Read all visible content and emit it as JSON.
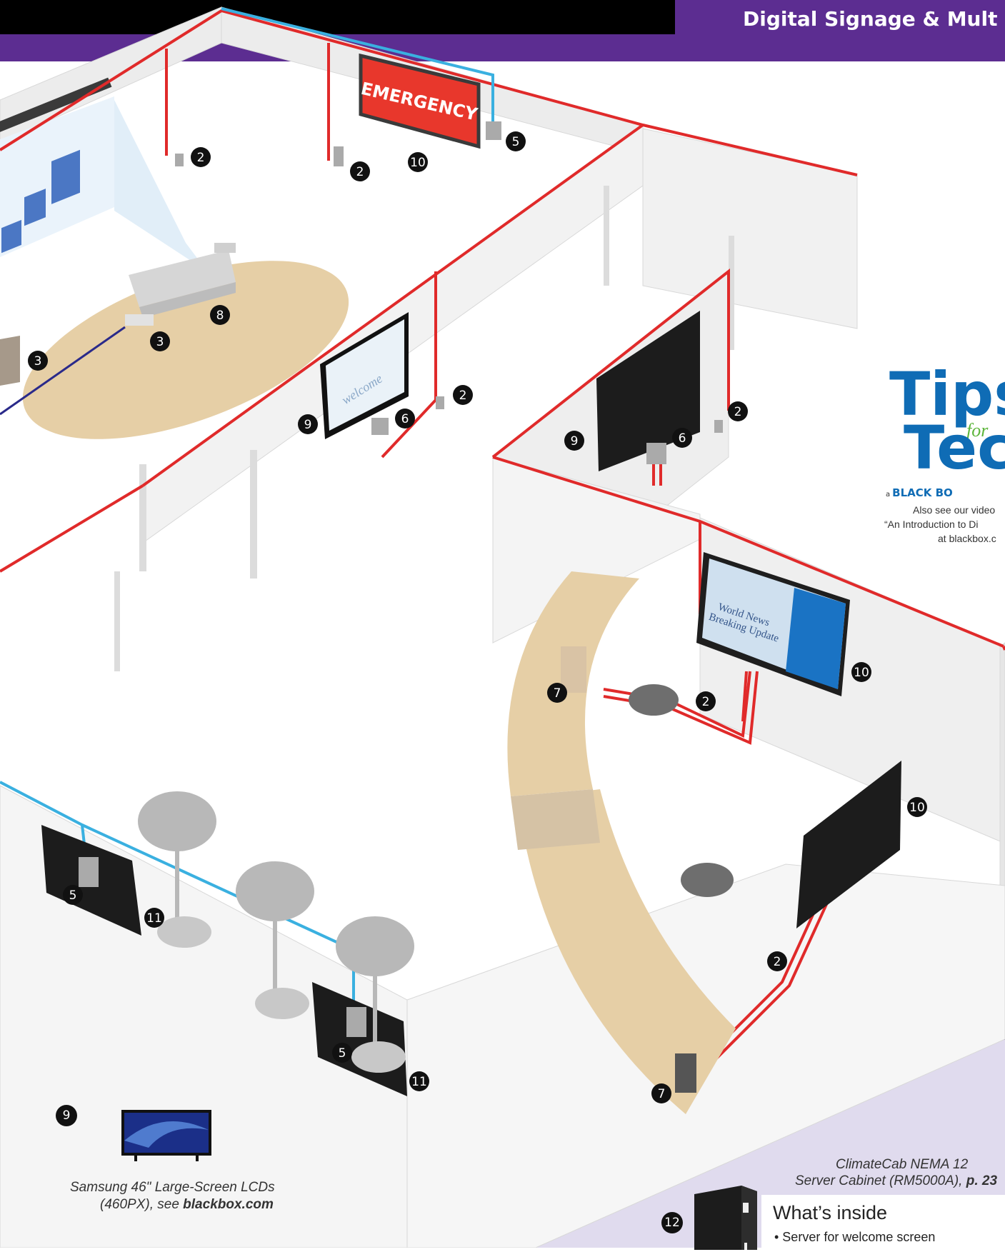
{
  "header": {
    "title": "Digital Signage & Mult"
  },
  "diagram": {
    "emergency_sign": "EMERGENCY",
    "welcome_screen": "welcome",
    "news_screen_line1": "World News",
    "news_screen_line2": "Breaking Update",
    "callouts": [
      "2",
      "2",
      "10",
      "5",
      "8",
      "3",
      "3",
      "9",
      "6",
      "2",
      "9",
      "6",
      "2",
      "10",
      "7",
      "2",
      "10",
      "5",
      "11",
      "2",
      "5",
      "11",
      "7"
    ]
  },
  "tips": {
    "word1": "Tips",
    "word2": "Tec",
    "for": "for",
    "brand_prefix": "a",
    "brand": "BLACK BO",
    "line1": "Also see our video",
    "line2": "“An Introduction to Di",
    "line3": "at blackbox.c"
  },
  "legend": {
    "badge_9": "9",
    "samsung_caption_line1": "Samsung 46\" Large-Screen LCDs",
    "samsung_caption_line2_prefix": "(460PX), see ",
    "samsung_caption_link": "blackbox.com",
    "cabinet_caption_line1": "ClimateCab NEMA 12",
    "cabinet_caption_line2_prefix": "Server Cabinet (RM5000A), ",
    "cabinet_caption_page": "p. 23",
    "badge_12": "12",
    "whats_inside_heading": "What’s inside",
    "whats_inside_item": "• Server for welcome screen"
  },
  "colors": {
    "header_black": "#000000",
    "header_purple": "#5c2d91",
    "cable_red": "#e02a2a",
    "cable_blue": "#3ab0e0",
    "legend_bg": "#e0dbee",
    "tips_blue": "#0f6cb5",
    "tips_green": "#5db53b"
  }
}
